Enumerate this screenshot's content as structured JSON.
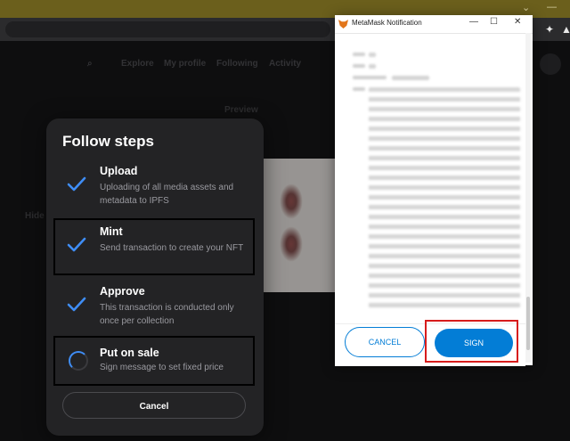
{
  "modal": {
    "title": "Follow steps",
    "steps": [
      {
        "title": "Upload",
        "description": "Uploading of all media assets and metadata to IPFS",
        "status": "done"
      },
      {
        "title": "Mint",
        "description": "Send transaction to create your NFT",
        "status": "done"
      },
      {
        "title": "Approve",
        "description": "This transaction is conducted only once per collection",
        "status": "done"
      },
      {
        "title": "Put on sale",
        "description": "Sign message to set fixed price",
        "status": "in-progress"
      }
    ],
    "cancel_label": "Cancel"
  },
  "metamask": {
    "window_title": "MetaMask Notification",
    "cancel_label": "CANCEL",
    "sign_label": "SIGN"
  },
  "site_nav": [
    "Explore",
    "My profile",
    "Following",
    "Activity"
  ],
  "site_preview_label": "Preview",
  "site_hide_label": "Hide",
  "colors": {
    "accent": "#3f8df5",
    "metamask_blue": "#037dd6",
    "highlight_red": "#d71c1c",
    "modal_bg": "#232325"
  }
}
